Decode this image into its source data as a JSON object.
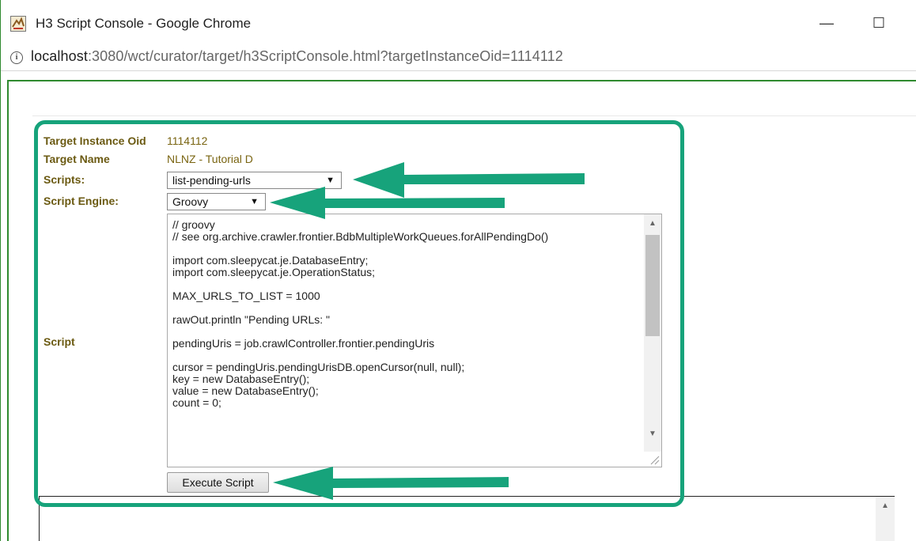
{
  "window": {
    "title": "H3 Script Console - Google Chrome",
    "minimize": "—",
    "maximize": "☐"
  },
  "address": {
    "host": "localhost",
    "path": ":3080/wct/curator/target/h3ScriptConsole.html?targetInstanceOid=1114112"
  },
  "form": {
    "oid_label": "Target Instance Oid",
    "oid_value": "1114112",
    "name_label": "Target Name",
    "name_value": "NLNZ - Tutorial D",
    "scripts_label": "Scripts:",
    "scripts_selected": "list-pending-urls",
    "engine_label": "Script Engine:",
    "engine_selected": "Groovy",
    "script_label": "Script",
    "script_text": "// groovy\n// see org.archive.crawler.frontier.BdbMultipleWorkQueues.forAllPendingDo()\n\nimport com.sleepycat.je.DatabaseEntry;\nimport com.sleepycat.je.OperationStatus;\n\nMAX_URLS_TO_LIST = 1000\n\nrawOut.println \"Pending URLs: \"\n\npendingUris = job.crawlController.frontier.pendingUris\n\ncursor = pendingUris.pendingUrisDB.openCursor(null, null);\nkey = new DatabaseEntry();\nvalue = new DatabaseEntry();\ncount = 0;",
    "execute_label": "Execute Script"
  },
  "colors": {
    "accent": "#17a37b",
    "label": "#6b5a12",
    "frame": "#2f8a2f"
  }
}
